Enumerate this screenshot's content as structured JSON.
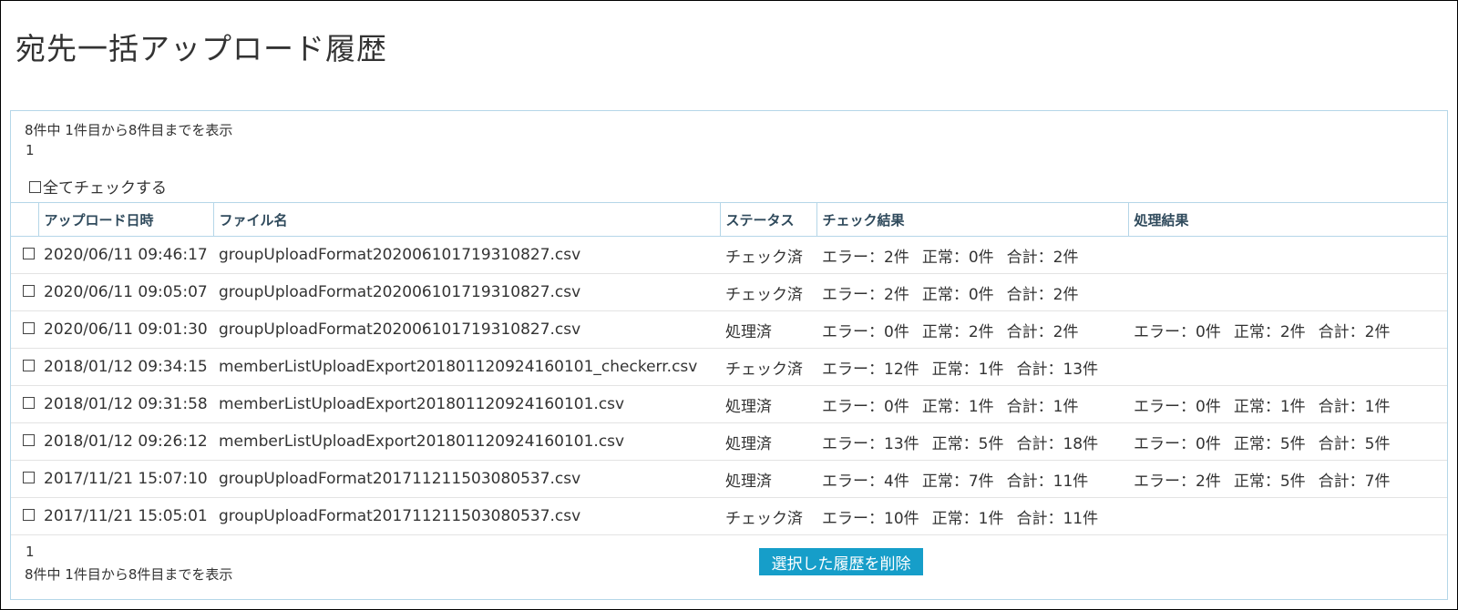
{
  "page": {
    "title": "宛先一括アップロード履歴"
  },
  "summary": {
    "text": "8件中 1件目から8件目までを表示"
  },
  "pager": {
    "current": "1"
  },
  "check_all": {
    "label": "全てチェックする"
  },
  "table": {
    "headers": [
      "",
      "アップロード日時",
      "ファイル名",
      "ステータス",
      "チェック結果",
      "処理結果"
    ],
    "rows": [
      {
        "datetime": "2020/06/11 09:46:17",
        "filename": "groupUploadFormat202006101719310827.csv",
        "status": "チェック済",
        "check": [
          "エラー：2件",
          "正常：0件",
          "合計：2件"
        ],
        "process": [
          "",
          "",
          ""
        ]
      },
      {
        "datetime": "2020/06/11 09:05:07",
        "filename": "groupUploadFormat202006101719310827.csv",
        "status": "チェック済",
        "check": [
          "エラー：2件",
          "正常：0件",
          "合計：2件"
        ],
        "process": [
          "",
          "",
          ""
        ]
      },
      {
        "datetime": "2020/06/11 09:01:30",
        "filename": "groupUploadFormat202006101719310827.csv",
        "status": "処理済",
        "check": [
          "エラー：0件",
          "正常：2件",
          "合計：2件"
        ],
        "process": [
          "エラー：0件",
          "正常：2件",
          "合計：2件"
        ]
      },
      {
        "datetime": "2018/01/12 09:34:15",
        "filename": "memberListUploadExport201801120924160101_checkerr.csv",
        "status": "チェック済",
        "check": [
          "エラー：12件",
          "正常：1件",
          "合計：13件"
        ],
        "process": [
          "",
          "",
          ""
        ]
      },
      {
        "datetime": "2018/01/12 09:31:58",
        "filename": "memberListUploadExport201801120924160101.csv",
        "status": "処理済",
        "check": [
          "エラー：0件",
          "正常：1件",
          "合計：1件"
        ],
        "process": [
          "エラー：0件",
          "正常：1件",
          "合計：1件"
        ]
      },
      {
        "datetime": "2018/01/12 09:26:12",
        "filename": "memberListUploadExport201801120924160101.csv",
        "status": "処理済",
        "check": [
          "エラー：13件",
          "正常：5件",
          "合計：18件"
        ],
        "process": [
          "エラー：0件",
          "正常：5件",
          "合計：5件"
        ]
      },
      {
        "datetime": "2017/11/21 15:07:10",
        "filename": "groupUploadFormat201711211503080537.csv",
        "status": "処理済",
        "check": [
          "エラー：4件",
          "正常：7件",
          "合計：11件"
        ],
        "process": [
          "エラー：2件",
          "正常：5件",
          "合計：7件"
        ]
      },
      {
        "datetime": "2017/11/21 15:05:01",
        "filename": "groupUploadFormat201711211503080537.csv",
        "status": "チェック済",
        "check": [
          "エラー：10件",
          "正常：1件",
          "合計：11件"
        ],
        "process": [
          "",
          "",
          ""
        ]
      }
    ]
  },
  "actions": {
    "delete_label": "選択した履歴を削除"
  },
  "colors": {
    "accent": "#169ec9",
    "border": "#b5d6e8",
    "header_text": "#2f4a5c"
  }
}
